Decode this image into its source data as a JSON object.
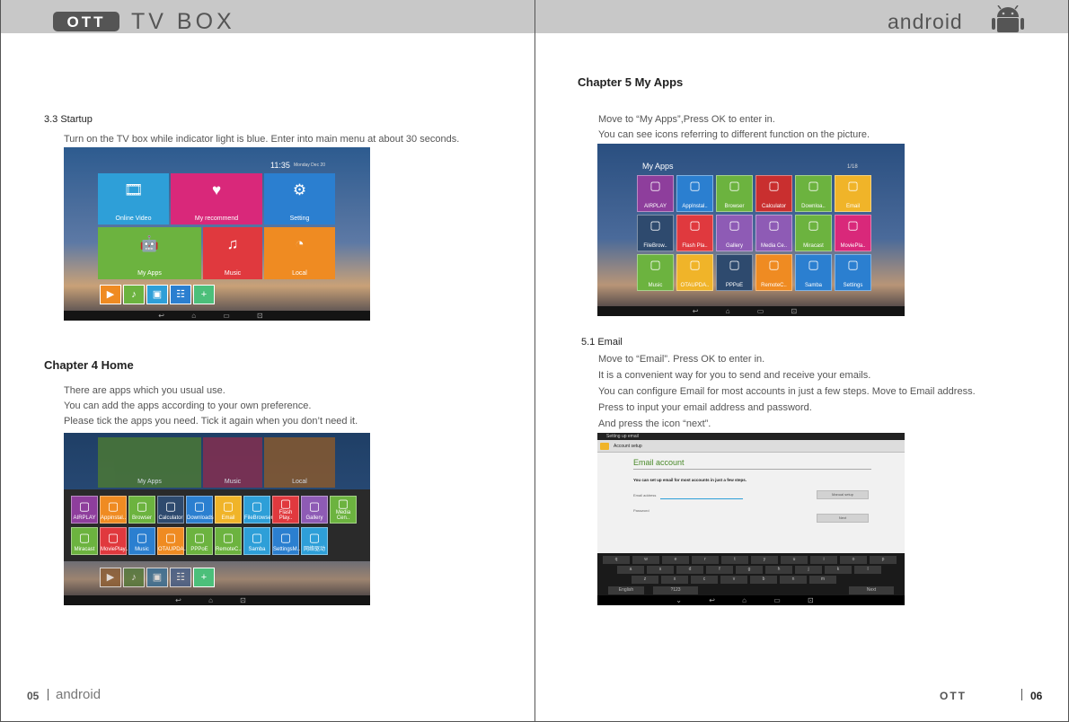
{
  "header_left": {
    "logo": "OTT",
    "title": "TV BOX"
  },
  "header_right": {
    "title": "android"
  },
  "left": {
    "startup": {
      "heading": "3.3 Startup",
      "text": "Turn on the TV box while indicator light is blue. Enter into main menu at about 30 seconds.",
      "screen": {
        "clock": "11:35",
        "date": "Monday Dec 20",
        "tiles": [
          "Online Video",
          "My recommend",
          "Setting",
          "My Apps",
          "Music",
          "Local"
        ]
      }
    },
    "chapter4": {
      "heading": "Chapter 4 Home",
      "lines": [
        "There are apps which you usual use.",
        "You can add the apps according to your own preference.",
        "Please tick the apps you need. Tick it again when you don’t need it."
      ],
      "screen": {
        "back_tiles": [
          "My Apps",
          "Music",
          "Local"
        ],
        "row1": [
          "AIRPLAY",
          "Appinstal..",
          "Browser",
          "Calculator",
          "Downloads",
          "Email",
          "FileBrowser",
          "Flash Play..",
          "Gallery",
          "Media Cen.."
        ],
        "row2": [
          "Miracast",
          "MoviePlay..",
          "Music",
          "OTAUPDA..",
          "PPPoE",
          "RemoteC..",
          "Samba",
          "SettingsM..",
          "网络驱动"
        ]
      }
    },
    "footer": {
      "page": "05",
      "brand": "android"
    }
  },
  "right": {
    "chapter5": {
      "heading": "Chapter 5 My Apps",
      "lines": [
        "Move to “My Apps”,Press OK to enter in.",
        "You can see icons referring to different function on the picture."
      ],
      "screen": {
        "title": "My Apps",
        "page": "1/18",
        "rows": [
          [
            "AIRPLAY",
            "AppInstal..",
            "Browser",
            "Calculator",
            "Downloa..",
            "Email"
          ],
          [
            "FileBrow..",
            "Flash Pla..",
            "Gallery",
            "Media Ce..",
            "Miracast",
            "MoviePla.."
          ],
          [
            "Music",
            "OTAUPDA..",
            "PPPoE",
            "RemoteC..",
            "Samba",
            "Settings"
          ]
        ]
      }
    },
    "email": {
      "heading": "5.1 Email",
      "lines": [
        "Move to “Email”. Press OK to enter in.",
        "It is a convenient way for you to send and receive your emails.",
        "You can configure Email for most accounts in just a few steps. Move to Email address.",
        "Press to input your email address and password.",
        "And press the icon “next”."
      ],
      "screen": {
        "topbar": "Setting up email",
        "section": "Account setup",
        "title": "Email account",
        "desc": "You can set up email for most accounts in just a few steps.",
        "field_email": "Email address",
        "field_password": "Password",
        "btn_manual": "Manual setup",
        "btn_next": "Next",
        "keys": [
          "q",
          "w",
          "e",
          "r",
          "t",
          "y",
          "u",
          "i",
          "o",
          "p",
          "a",
          "s",
          "d",
          "f",
          "g",
          "h",
          "j",
          "k",
          "l",
          "z",
          "x",
          "c",
          "v",
          "b",
          "n",
          "m"
        ],
        "key_lang": "English",
        "key_num": "?123",
        "key_done": "Next"
      }
    },
    "footer": {
      "brand": "OTT",
      "page": "06"
    }
  },
  "colors": {
    "header": "#c8c8c8",
    "video": "#2e9fd8",
    "recommend": "#d9287a",
    "setting": "#2b7fd0",
    "apps": "#6cb33f",
    "music": "#e0393e",
    "local": "#ef8b22"
  }
}
